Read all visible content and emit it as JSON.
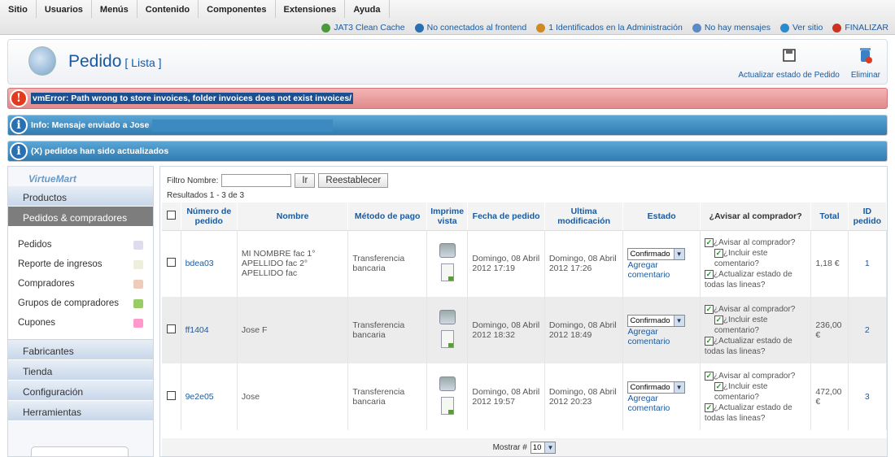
{
  "menu": [
    "Sitio",
    "Usuarios",
    "Menús",
    "Contenido",
    "Componentes",
    "Extensiones",
    "Ayuda"
  ],
  "status": [
    {
      "label": "JAT3 Clean Cache",
      "icon": "refresh-icon"
    },
    {
      "label": "No conectados al frontend",
      "icon": "user-icon"
    },
    {
      "label": "1 Identificados en la Administración",
      "icon": "users-icon"
    },
    {
      "label": "No hay mensajes",
      "icon": "mail-icon"
    },
    {
      "label": "Ver sitio",
      "icon": "screen-icon"
    },
    {
      "label": "FINALIZAR",
      "icon": "power-icon"
    }
  ],
  "header": {
    "title": "Pedido",
    "subtitle": "[ Lista ]",
    "btn_update": "Actualizar estado de Pedido",
    "btn_delete": "Eliminar"
  },
  "messages": {
    "error": "vmError: Path wrong to store invoices, folder invoices does not exist invoices/",
    "info": "Info: Mensaje enviado a Jose",
    "updated": "(X) pedidos han sido actualizados"
  },
  "sidebar": {
    "logo": "VirtueMart",
    "top": "Productos",
    "active": "Pedidos & compradores",
    "sub": [
      "Pedidos",
      "Reporte de ingresos",
      "Compradores",
      "Grupos de compradores",
      "Cupones"
    ],
    "bottom": [
      "Fabricantes",
      "Tienda",
      "Configuración",
      "Herramientas"
    ]
  },
  "filter": {
    "label": "Filtro Nombre:",
    "go": "Ir",
    "reset": "Reestablecer",
    "results": "Resultados 1 - 3 de 3"
  },
  "columns": [
    "Número de pedido",
    "Nombre",
    "Método de pago",
    "Imprime vista",
    "Fecha de pedido",
    "Ultima modificación",
    "Estado",
    "¿Avisar al comprador?",
    "Total",
    "ID pedido"
  ],
  "rows": [
    {
      "num": "bdea03",
      "name": "MI NOMBRE fac 1° APELLIDO fac 2° APELLIDO fac",
      "pay": "Transferencia bancaria",
      "date": "Domingo, 08 Abril 2012 17:19",
      "mod": "Domingo, 08 Abril 2012 17:26",
      "status": "Confirmado",
      "total": "1,18 €",
      "id": "1"
    },
    {
      "num": "ff1404",
      "name": "Jose F",
      "pay": "Transferencia bancaria",
      "date": "Domingo, 08 Abril 2012 18:32",
      "mod": "Domingo, 08 Abril 2012 18:49",
      "status": "Confirmado",
      "total": "236,00 €",
      "id": "2"
    },
    {
      "num": "9e2e05",
      "name": "Jose",
      "pay": "Transferencia bancaria",
      "date": "Domingo, 08 Abril 2012 19:57",
      "mod": "Domingo, 08 Abril 2012 20:23",
      "status": "Confirmado",
      "total": "472,00 €",
      "id": "3"
    }
  ],
  "row_labels": {
    "add_comment": "Agregar comentario",
    "notify": "¿Avisar al comprador?",
    "include": "¿Incluir este comentario?",
    "update_lines": "¿Actualizar estado de todas las lineas?"
  },
  "footer": {
    "label": "Mostrar #",
    "value": "10"
  }
}
